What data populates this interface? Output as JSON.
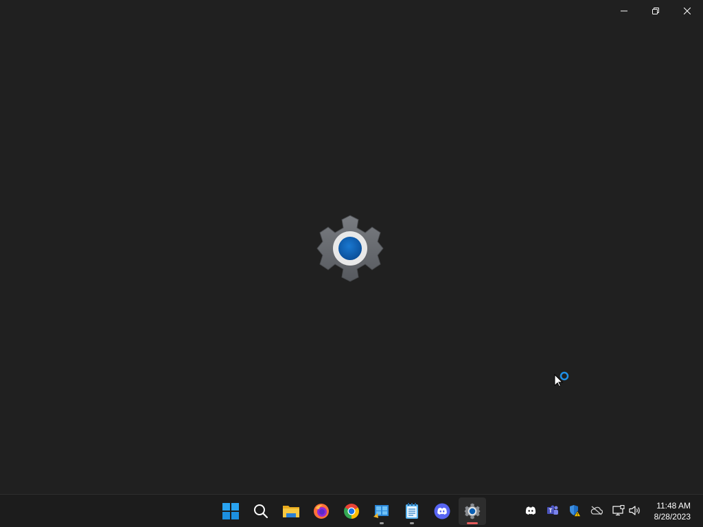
{
  "window": {
    "splash_icon": "settings-gear-icon",
    "caption": {
      "minimize": "minimize-icon",
      "restore": "restore-icon",
      "close": "close-icon"
    }
  },
  "taskbar": {
    "apps": [
      {
        "name": "start",
        "icon": "windows-logo-icon"
      },
      {
        "name": "search",
        "icon": "search-icon"
      },
      {
        "name": "file-explorer",
        "icon": "folder-icon"
      },
      {
        "name": "firefox",
        "icon": "firefox-icon"
      },
      {
        "name": "chrome",
        "icon": "chrome-icon"
      },
      {
        "name": "control-panel",
        "icon": "control-panel-icon",
        "running": true
      },
      {
        "name": "notepad",
        "icon": "notepad-icon",
        "running": true
      },
      {
        "name": "discord",
        "icon": "discord-icon"
      },
      {
        "name": "settings",
        "icon": "settings-gear-icon",
        "active": true
      }
    ],
    "tray": [
      "discord-tray-icon",
      "teams-icon",
      "defender-warning-icon",
      "onedrive-offline-icon",
      "network-icon",
      "volume-icon"
    ],
    "clock": {
      "time": "11:48 AM",
      "date": "8/28/2023"
    }
  },
  "colors": {
    "background": "#202020",
    "taskbar": "#1c1c1c",
    "accent": "#0a5fb4",
    "active_indicator": "#e35c5c"
  }
}
